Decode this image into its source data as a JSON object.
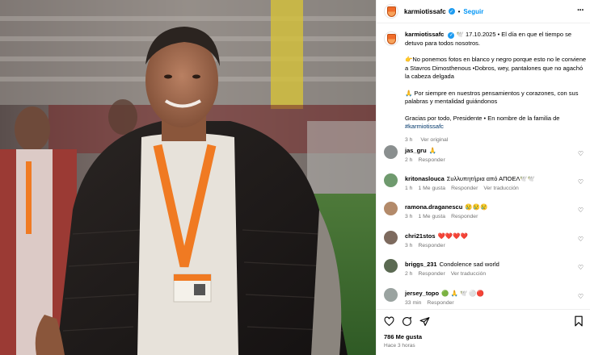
{
  "header": {
    "username": "karmiotissafc",
    "follow_label": "Seguir"
  },
  "caption": {
    "username": "karmiotissafc",
    "date_line": "🕊️ 17.10.2025 • El día en que el tiempo se detuvo para todos nosotros.",
    "para1": "👉No ponemos fotos en blanco y negro porque esto no le conviene a Stavros Dimosthenous •Dobros, wey, pantalones que no agachó la cabeza delgada",
    "para2": "🙏 Por siempre en nuestros pensamientos y corazones, con sus palabras y mentalidad guiándonos",
    "para3": "Gracias por todo, Presidente • En nombre de la familia de",
    "hashtag": "#karmiotissafc",
    "time": "3 h",
    "see_original": "Ver original"
  },
  "comments": [
    {
      "user": "jas_gru",
      "text": "🙏",
      "time": "2 h",
      "actions": [
        "Responder"
      ],
      "avatar_color": "#8a8f8f"
    },
    {
      "user": "kritonaslouca",
      "text": "Συλλυπητήρια από ΑΠΟΕΛ🕊️🕊️",
      "time": "1 h",
      "actions": [
        "1 Me gusta",
        "Responder",
        "Ver traducción"
      ],
      "avatar_color": "#6f9a6e"
    },
    {
      "user": "ramona.draganescu",
      "text": "😢😢😢",
      "time": "3 h",
      "actions": [
        "1 Me gusta",
        "Responder"
      ],
      "avatar_color": "#b38a6a"
    },
    {
      "user": "chri21stos",
      "text": "❤️❤️❤️❤️",
      "time": "3 h",
      "actions": [
        "Responder"
      ],
      "avatar_color": "#7d6a5e"
    },
    {
      "user": "briggs_231",
      "text": "Condolence sad world",
      "time": "2 h",
      "actions": [
        "Responder",
        "Ver traducción"
      ],
      "avatar_color": "#5b6a52"
    },
    {
      "user": "jersey_topo",
      "text": "🟢 🙏 🕊️ ⚪🔴",
      "time": "33 min",
      "actions": [
        "Responder"
      ],
      "avatar_color": "#9aa3a0"
    }
  ],
  "actions": {
    "likes": "786 Me gusta",
    "timestamp": "Hace 3 horas"
  },
  "icons": {
    "more": "more-icon",
    "heart": "heart-icon",
    "comment": "comment-icon",
    "share": "share-icon",
    "bookmark": "bookmark-icon",
    "verified": "verified-badge-icon"
  },
  "colors": {
    "link_blue": "#0095f6",
    "verified_blue": "#1d9bf0",
    "meta_grey": "#737373",
    "lanyard_orange": "#f07a22"
  }
}
